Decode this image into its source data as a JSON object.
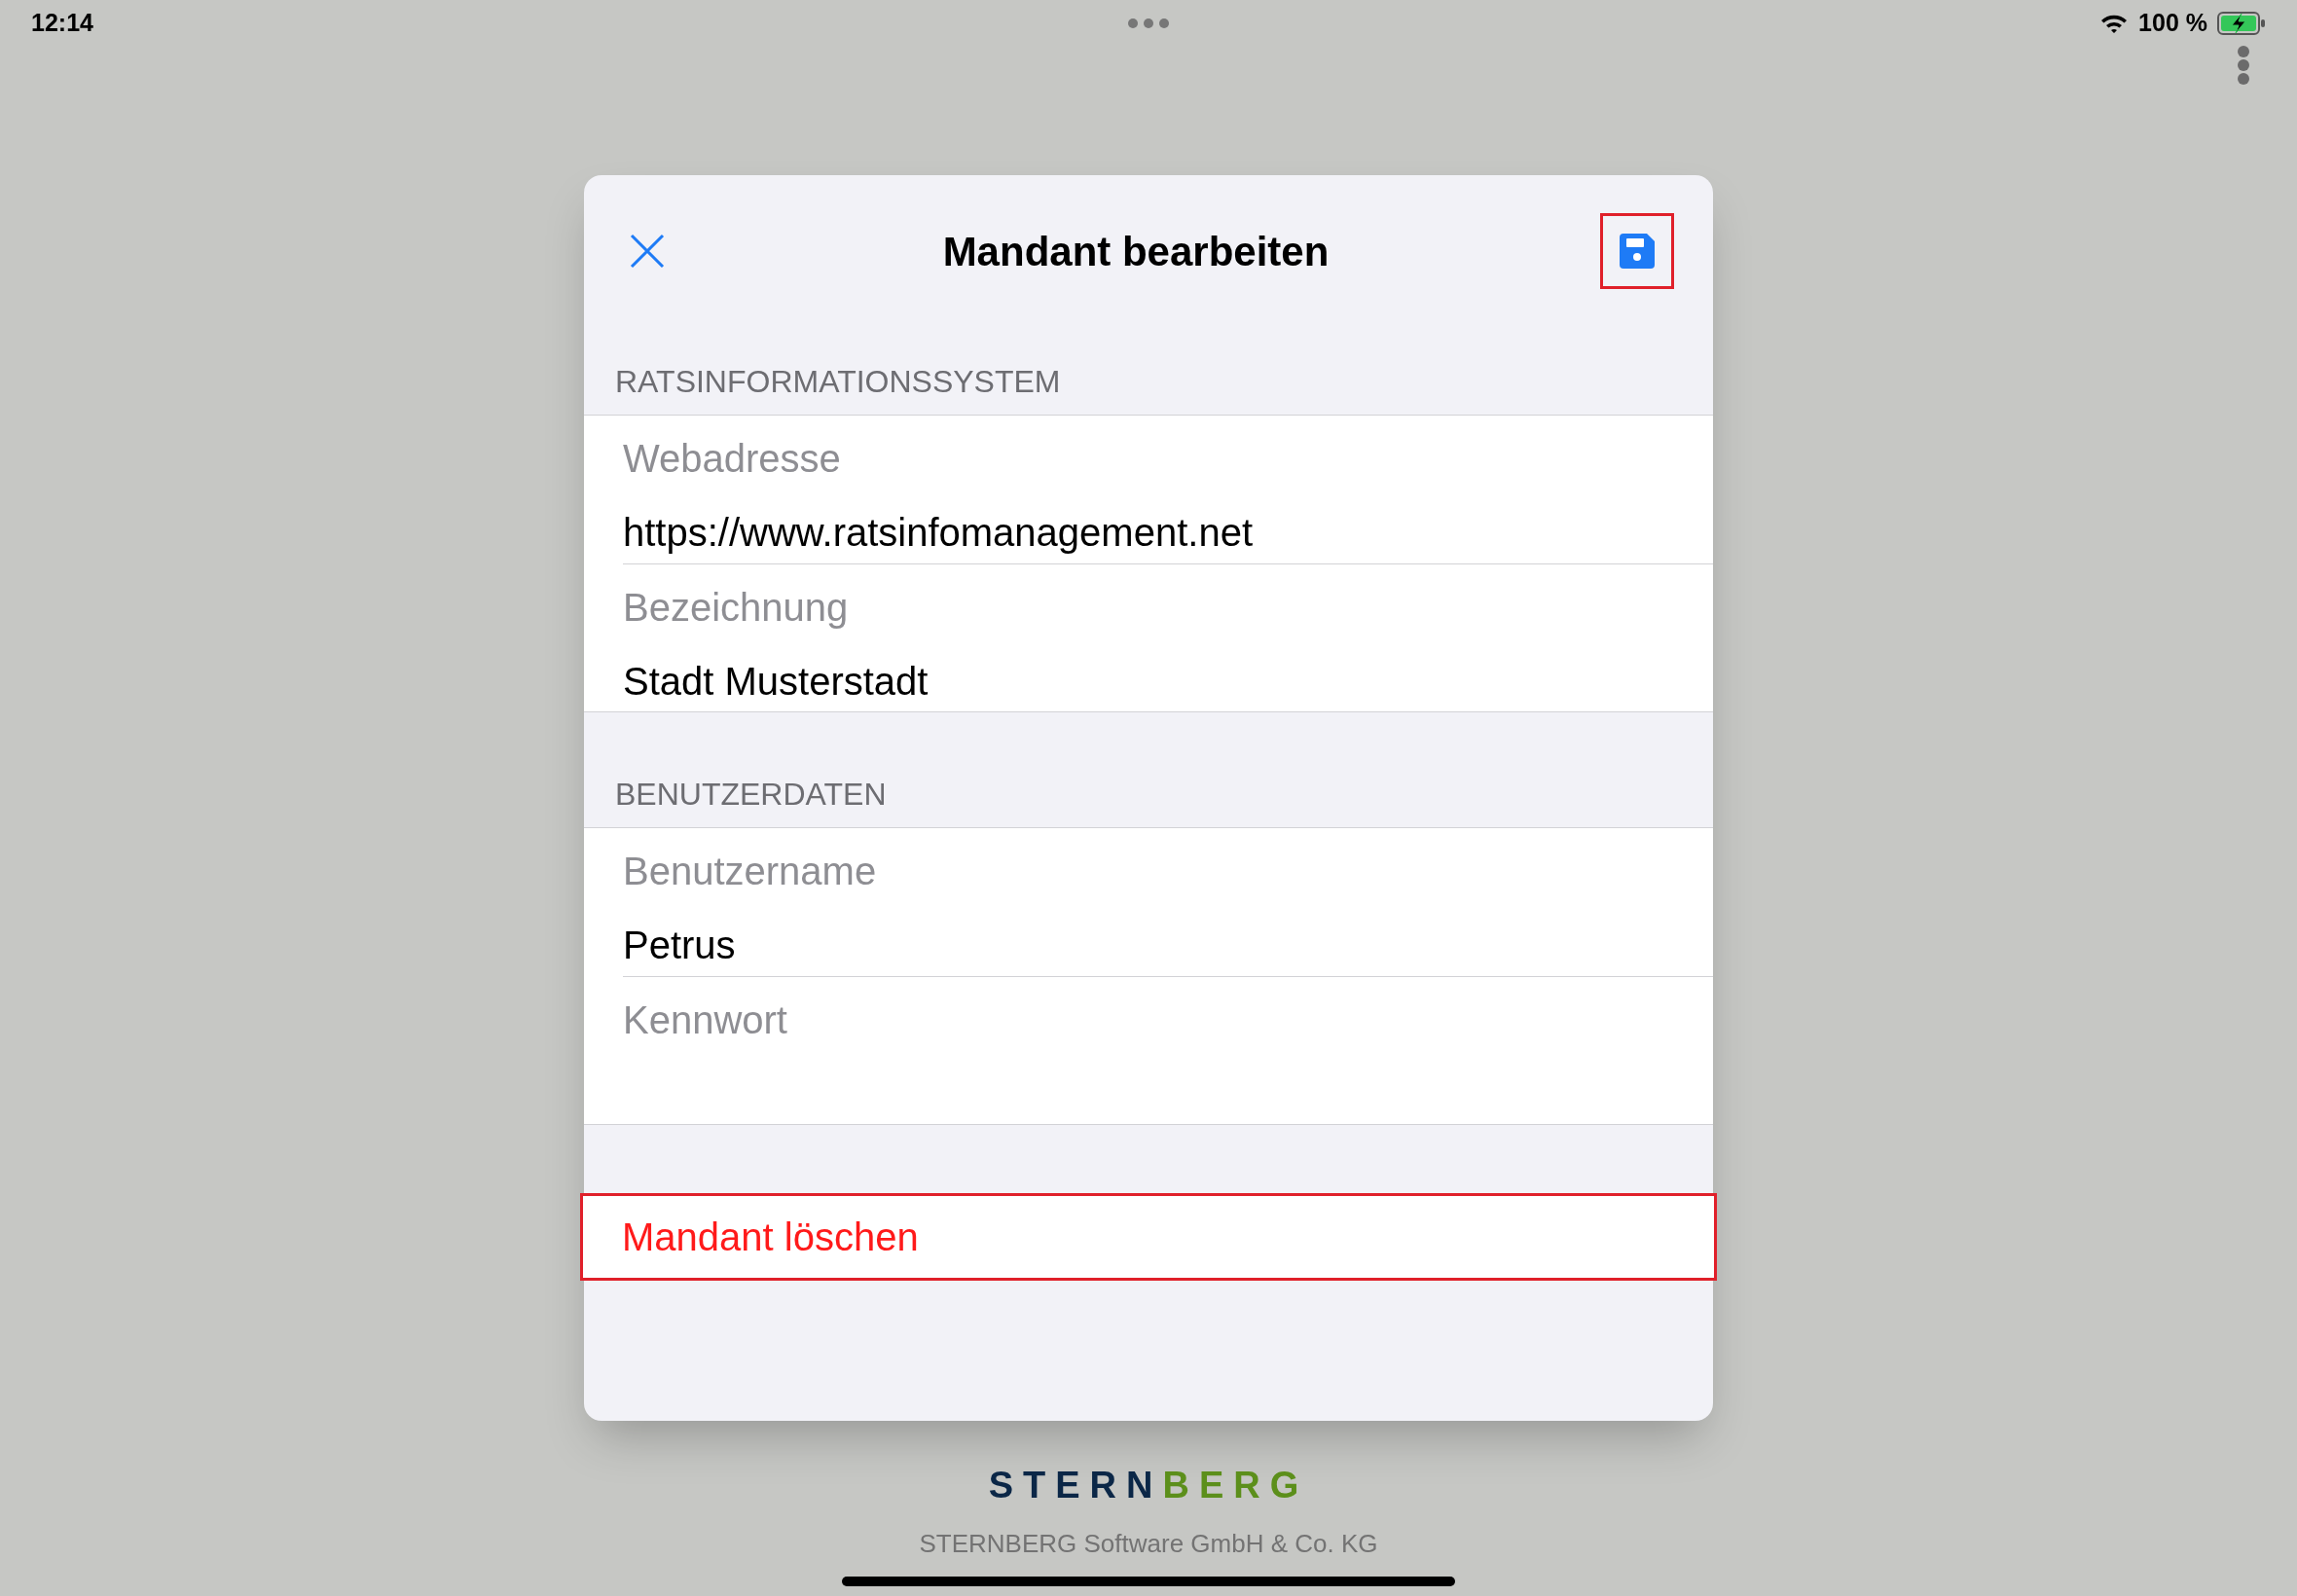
{
  "status_bar": {
    "time": "12:14",
    "battery": "100 %",
    "charging": true
  },
  "dialog": {
    "title": "Mandant bearbeiten",
    "save_highlighted": true,
    "sections": [
      {
        "header": "RATSINFORMATIONSSYSTEM",
        "fields": [
          {
            "label": "Webadresse",
            "value": "https://www.ratsinfomanagement.net"
          },
          {
            "label": "Bezeichnung",
            "value": "Stadt Musterstadt"
          }
        ]
      },
      {
        "header": "BENUTZERDATEN",
        "fields": [
          {
            "label": "Benutzername",
            "value": "Petrus"
          },
          {
            "label": "Kennwort"
          }
        ]
      }
    ],
    "delete": {
      "label": "Mandant löschen",
      "highlighted": true
    }
  },
  "footer": {
    "logo": [
      {
        "text": "STERN",
        "color": "#0b2747"
      },
      {
        "text": "BERG",
        "color": "#5c8f1b"
      }
    ],
    "company": "STERNBERG Software GmbH & Co. KG"
  }
}
